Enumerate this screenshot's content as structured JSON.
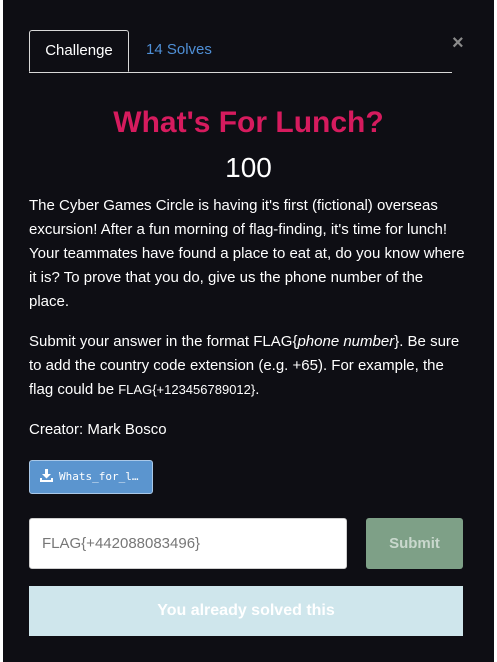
{
  "tabs": {
    "challenge": "Challenge",
    "solves": "14 Solves"
  },
  "close_glyph": "×",
  "challenge": {
    "name": "What's For Lunch?",
    "points": "100",
    "description_1": "The Cyber Games Circle is having it's first (fictional) overseas excursion! After a fun morning of flag-finding, it's time for lunch! Your teammates have found a place to eat at, do you know where it is? To prove that you do, give us the phone number of the place.",
    "description_2_a": "Submit your answer in the format FLAG{",
    "description_2_italic": "phone number",
    "description_2_b": "}. Be sure to add the country code extension (e.g. +65). For example, the flag could be ",
    "description_2_code": "FLAG{+123456789012}",
    "description_2_c": ".",
    "creator": "Creator: Mark Bosco"
  },
  "file": {
    "label": "Whats_for_l…",
    "icon": "download-icon"
  },
  "answer": {
    "value": "FLAG{+442088083496}"
  },
  "submit_label": "Submit",
  "solved_message": "You already solved this",
  "colors": {
    "title": "#d61b5e",
    "tab_link": "#4f8fd6",
    "background": "#0e0e14",
    "submit": "#7ea087",
    "solved_bg": "#cfe6ec",
    "file_button": "#5b95cf"
  }
}
